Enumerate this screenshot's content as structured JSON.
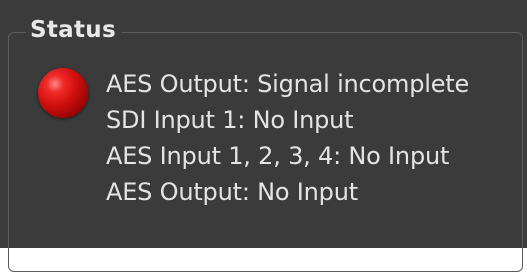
{
  "status_group": {
    "title": "Status",
    "indicator": {
      "color": "#d00f0f",
      "state": "error"
    },
    "lines": [
      "AES Output: Signal incomplete",
      "SDI Input 1: No Input",
      "AES Input 1, 2, 3, 4: No Input",
      "AES Output: No Input"
    ]
  }
}
